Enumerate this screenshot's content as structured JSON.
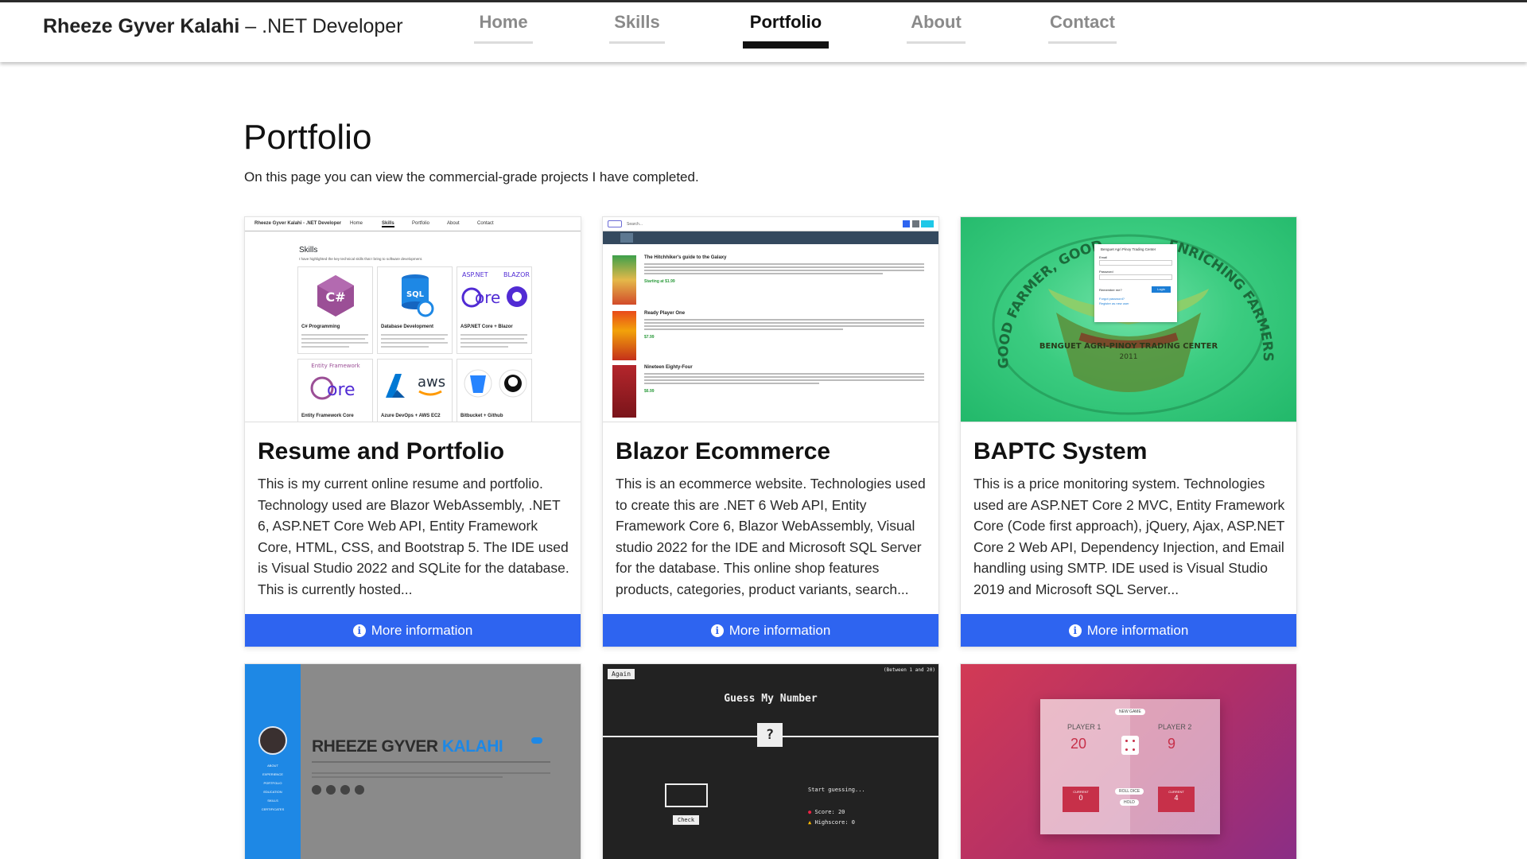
{
  "brand": {
    "name": "Rheeze Gyver Kalahi",
    "separator": " – ",
    "role": ".NET Developer"
  },
  "nav": [
    {
      "label": "Home",
      "active": false
    },
    {
      "label": "Skills",
      "active": false
    },
    {
      "label": "Portfolio",
      "active": true
    },
    {
      "label": "About",
      "active": false
    },
    {
      "label": "Contact",
      "active": false
    }
  ],
  "page": {
    "title": "Portfolio",
    "subtitle": "On this page you can view the commercial-grade projects I have completed."
  },
  "cards": [
    {
      "title": "Resume and Portfolio",
      "description": "This is my current online resume and portfolio. Technology used are Blazor WebAssembly, .NET 6, ASP.NET Core Web API, Entity Framework Core, HTML, CSS, and Bootstrap 5. The IDE used is Visual Studio 2022 and SQLite for the database. This is currently hosted...",
      "button": "More information"
    },
    {
      "title": "Blazor Ecommerce",
      "description": "This is an ecommerce website. Technologies used to create this are .NET 6 Web API, Entity Framework Core 6, Blazor WebAssembly, Visual studio 2022 for the IDE and Microsoft SQL Server for the database. This online shop features products, categories, product variants, search...",
      "button": "More information"
    },
    {
      "title": "BAPTC System",
      "description": "This is a price monitoring system. Technologies used are ASP.NET Core 2 MVC, Entity Framework Core (Code first approach), jQuery, Ajax, ASP.NET Core 2 Web API, Dependency Injection, and Email handling using SMTP. IDE used is Visual Studio 2019 and Microsoft SQL Server...",
      "button": "More information"
    }
  ],
  "thumb_resume": {
    "nav_brand": "Rheeze Gyver Kalahi - .NET Developer",
    "nav_items": [
      "Home",
      "Skills",
      "Portfolio",
      "About",
      "Contact"
    ],
    "heading": "Skills",
    "blurb": "I have highlighted the key technical skills that I bring to software development.",
    "skills": [
      "C# Programming",
      "Database Development",
      "ASP.NET Core + Blazor",
      "Entity Framework Core",
      "Azure DevOps + AWS EC2",
      "Bitbucket + Github"
    ],
    "tile_texts": {
      "csharp": "C#",
      "sql": "SQL",
      "aspnet": "ASP.NET",
      "blazor": "BLAZOR",
      "core": "ore",
      "ef": "Entity Framework",
      "aws": "aws"
    }
  },
  "thumb_ecommerce": {
    "search": "Search...",
    "books": [
      {
        "title": "The Hitchhiker's guide to the Galaxy",
        "price": "Starting at $1.99"
      },
      {
        "title": "Ready Player One",
        "price": "$7.99"
      },
      {
        "title": "Nineteen Eighty-Four",
        "price": "$6.99"
      }
    ]
  },
  "thumb_baptc": {
    "ring_text_left": "GOOD FARMER, GOOD HARVEST",
    "ring_text_right": "ENRICHING FARMERS LIVES",
    "center_name": "BENGUET AGRI-PINOY TRADING CENTER",
    "year": "2011",
    "login_title": "Benguet Agri Pinoy Trading Center",
    "email_label": "Email",
    "password_label": "Password",
    "remember": "Remember me?",
    "forgot": "Forgot password?",
    "register": "Register as new user",
    "login_button": "Login"
  },
  "thumb_resume2": {
    "first": "RHEEZE GYVER",
    "last": "KALAHI",
    "side": [
      "ABOUT",
      "EXPERIENCE",
      "PORTFOLIO",
      "EDUCATION",
      "SKILLS",
      "CERTIFICATES"
    ]
  },
  "thumb_guess": {
    "again": "Again",
    "range": "(Between 1 and 20)",
    "title": "Guess My Number",
    "secret": "?",
    "check": "Check",
    "status": "Start guessing...",
    "score": "Score: 20",
    "highscore": "Highscore: 0"
  },
  "thumb_pig": {
    "new_game": "NEW GAME",
    "p1": "PLAYER 1",
    "p1_score": "20",
    "p1_current": "0",
    "p2": "PLAYER 2",
    "p2_score": "9",
    "p2_current": "4",
    "roll": "ROLL DICE",
    "hold": "HOLD",
    "current": "CURRENT"
  },
  "colors": {
    "button": "#2e64f0",
    "nav_active": "#111111",
    "nav_inactive": "#8a8a8a"
  }
}
